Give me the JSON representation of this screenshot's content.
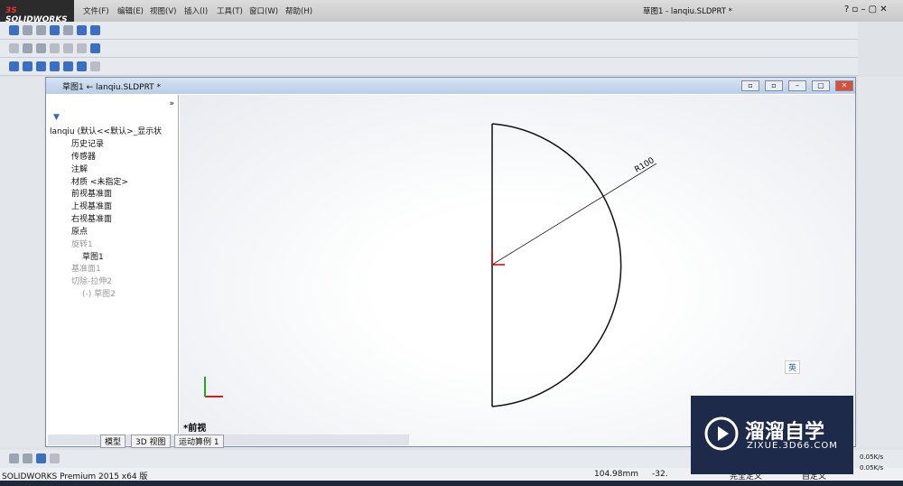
{
  "app": {
    "logo": "SOLIDWORKS",
    "doc_title": "草图1 - lanqiu.SLDPRT *"
  },
  "menu": [
    "文件(F)",
    "编辑(E)",
    "视图(V)",
    "插入(I)",
    "工具(T)",
    "窗口(W)",
    "帮助(H)"
  ],
  "document": {
    "title": "草图1 ← lanqiu.SLDPRT *"
  },
  "tree": {
    "root": "lanqiu (默认<<默认>_显示状",
    "items": [
      "历史记录",
      "传感器",
      "注解",
      "材质 <未指定>",
      "前视基准面",
      "上视基准面",
      "右视基准面",
      "原点",
      "旋转1",
      "草图1",
      "基准面1",
      "切除-拉伸2",
      "(-) 草图2"
    ],
    "expand": "»"
  },
  "tabs": [
    "模型",
    "3D 视图",
    "运动算例 1"
  ],
  "view_label": "*前视",
  "dimension": {
    "label": "R100",
    "radius": 100
  },
  "ime": "英",
  "status": {
    "product": "SOLIDWORKS Premium 2015 x64 版",
    "coord_x": "104.98mm",
    "coord_y": "-32.",
    "state": "完全定义",
    "units": "自定义",
    "net_up": "0.05K/s",
    "net_down": "0.05K/s"
  },
  "watermark": {
    "name": "溜溜自学",
    "url": "ZIXUE.3D66.COM"
  },
  "colors": {
    "sketch": "#111111",
    "accent": "#3a6fc4",
    "watermark_bg": "#1e2a4a"
  }
}
